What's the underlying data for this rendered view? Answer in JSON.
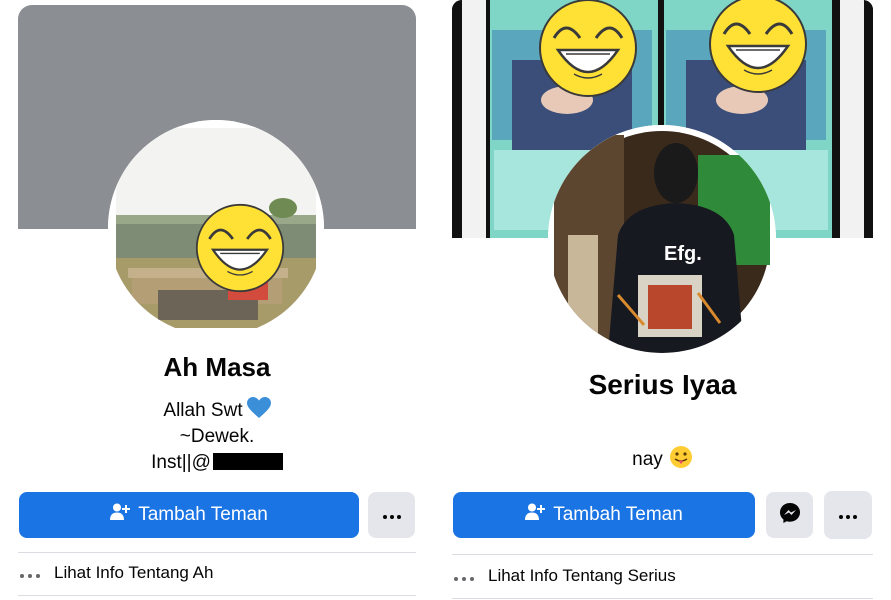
{
  "profiles": [
    {
      "name": "Ah Masa",
      "bio": [
        "Allah Swt",
        "~Dewek.",
        "Inst||@"
      ],
      "add_friend_label": "Tambah Teman",
      "info_link": "Lihat Info Tentang Ah"
    },
    {
      "name": "Serius Iyaa",
      "bio": [
        "nay"
      ],
      "add_friend_label": "Tambah Teman",
      "avatar_jacket_text": "Efg.",
      "info_link": "Lihat Info Tentang Serius"
    }
  ],
  "icons": {
    "add_friend": "person-plus-icon",
    "more": "ellipsis-icon",
    "messenger": "messenger-icon",
    "blue_heart": "blue-heart-emoji",
    "tongue": "tongue-out-emoji"
  },
  "colors": {
    "primary_button": "#1b74e4",
    "secondary_button": "#e4e6eb",
    "cover_gray": "#8b8f93",
    "emoji_yellow": "#ffe135"
  }
}
